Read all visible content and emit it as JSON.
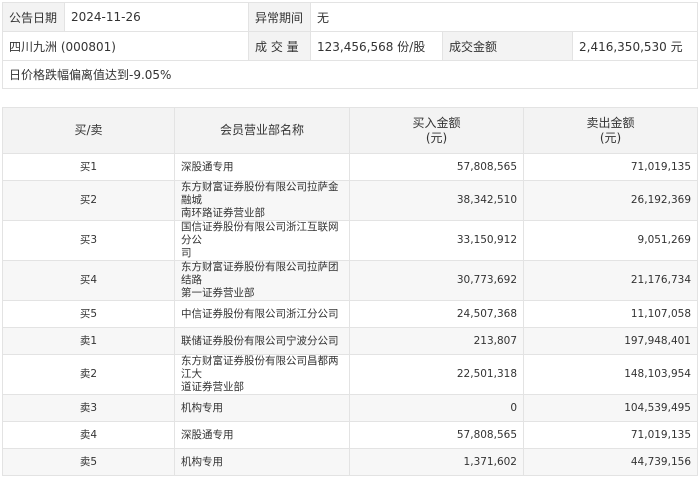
{
  "info": {
    "date_label": "公告日期",
    "date_value": "2024-11-26",
    "period_label": "异常期间",
    "period_value": "无",
    "stock_name": "四川九洲 (000801)",
    "volume_label": "成 交 量",
    "volume_value": "123,456,568 份/股",
    "amount_label": "成交金额",
    "amount_value": "2,416,350,530 元",
    "reason": "日价格跌幅偏离值达到-9.05%"
  },
  "table": {
    "headers": {
      "side": "买/卖",
      "branch": "会员营业部名称",
      "buy": "买入金额",
      "sell": "卖出金额",
      "unit": "(元)"
    },
    "rows": [
      {
        "type": "买1",
        "branch_l1": "深股通专用",
        "branch_l2": "",
        "buy": "57,808,565",
        "sell": "71,019,135"
      },
      {
        "type": "买2",
        "branch_l1": "东方财富证券股份有限公司拉萨金融城",
        "branch_l2": "南环路证券营业部",
        "buy": "38,342,510",
        "sell": "26,192,369"
      },
      {
        "type": "买3",
        "branch_l1": "国信证券股份有限公司浙江互联网分公",
        "branch_l2": "司",
        "buy": "33,150,912",
        "sell": "9,051,269"
      },
      {
        "type": "买4",
        "branch_l1": "东方财富证券股份有限公司拉萨团结路",
        "branch_l2": "第一证券营业部",
        "buy": "30,773,692",
        "sell": "21,176,734"
      },
      {
        "type": "买5",
        "branch_l1": "中信证券股份有限公司浙江分公司",
        "branch_l2": "",
        "buy": "24,507,368",
        "sell": "11,107,058"
      },
      {
        "type": "卖1",
        "branch_l1": "联储证券股份有限公司宁波分公司",
        "branch_l2": "",
        "buy": "213,807",
        "sell": "197,948,401"
      },
      {
        "type": "卖2",
        "branch_l1": "东方财富证券股份有限公司昌都两江大",
        "branch_l2": "道证券营业部",
        "buy": "22,501,318",
        "sell": "148,103,954"
      },
      {
        "type": "卖3",
        "branch_l1": "机构专用",
        "branch_l2": "",
        "buy": "0",
        "sell": "104,539,495"
      },
      {
        "type": "卖4",
        "branch_l1": "深股通专用",
        "branch_l2": "",
        "buy": "57,808,565",
        "sell": "71,019,135"
      },
      {
        "type": "卖5",
        "branch_l1": "机构专用",
        "branch_l2": "",
        "buy": "1,371,602",
        "sell": "44,739,156"
      }
    ]
  }
}
